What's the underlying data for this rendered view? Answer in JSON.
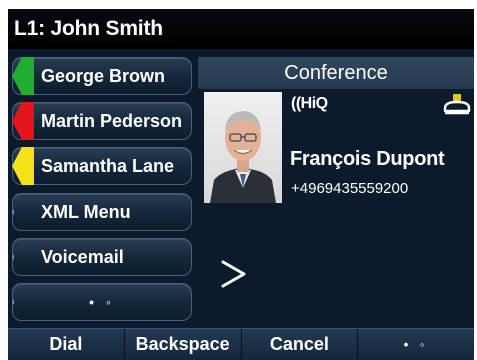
{
  "title": "L1: John Smith",
  "line_keys": [
    {
      "label": "George Brown",
      "status_color": "#1fae2f"
    },
    {
      "label": "Martin Pederson",
      "status_color": "#e3141c"
    },
    {
      "label": "Samantha Lane",
      "status_color": "#f3e21a"
    },
    {
      "label": "XML Menu"
    },
    {
      "label": "Voicemail"
    },
    {
      "label": "• ◦"
    }
  ],
  "conference": {
    "header": "Conference",
    "hiq_label": "((HiQ",
    "caller_name": "François Dupont",
    "caller_number": "+4969435559200",
    "next_arrow": ">"
  },
  "softkeys": [
    "Dial",
    "Backspace",
    "Cancel",
    "• ◦"
  ],
  "colors": {
    "background": "#0c1a2b",
    "accent_icon": "#e8c21f"
  }
}
